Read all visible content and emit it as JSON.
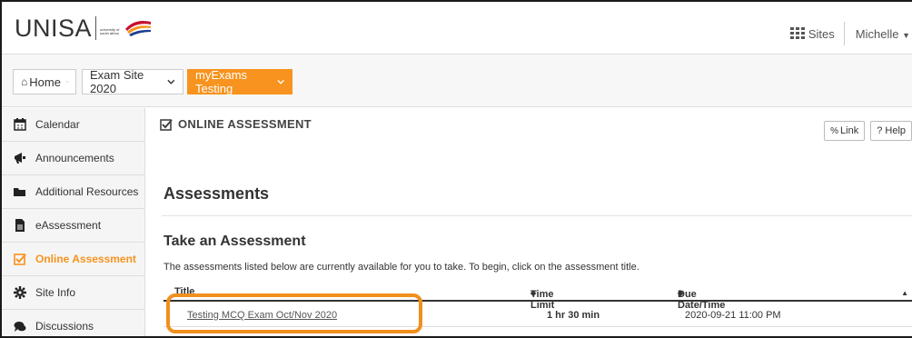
{
  "header": {
    "logo_text": "UNISA",
    "logo_subtext": "university of south africa",
    "sites_label": "Sites",
    "user_label": "Michelle"
  },
  "sitenav": {
    "home_label": "Home",
    "site_label": "Exam Site 2020",
    "active_label": "myExams Testing"
  },
  "sidebar": {
    "items": [
      {
        "label": "Calendar",
        "icon": "calendar-icon"
      },
      {
        "label": "Announcements",
        "icon": "bullhorn-icon"
      },
      {
        "label": "Additional Resources",
        "icon": "folder-icon"
      },
      {
        "label": "eAssessment",
        "icon": "file-icon"
      },
      {
        "label": "Online Assessment",
        "icon": "check-square-icon"
      },
      {
        "label": "Site Info",
        "icon": "gear-icon"
      },
      {
        "label": "Discussions",
        "icon": "comments-icon"
      }
    ]
  },
  "main": {
    "tool_title": "ONLINE ASSESSMENT",
    "link_label": "Link",
    "help_label": "? Help",
    "heading": "Assessments",
    "subheading": "Take an Assessment",
    "description": "The assessments listed below are currently available for you to take. To begin, click on the assessment title.",
    "table": {
      "columns": [
        "Title",
        "Time Limit",
        "Due Date/Time"
      ],
      "rows": [
        {
          "title": "Testing MCQ Exam Oct/Nov 2020",
          "time_limit": "1 hr 30 min",
          "due": "2020-09-21 11:00 PM"
        }
      ]
    }
  },
  "colors": {
    "accent": "#f7931e",
    "highlight": "#f0901e"
  }
}
